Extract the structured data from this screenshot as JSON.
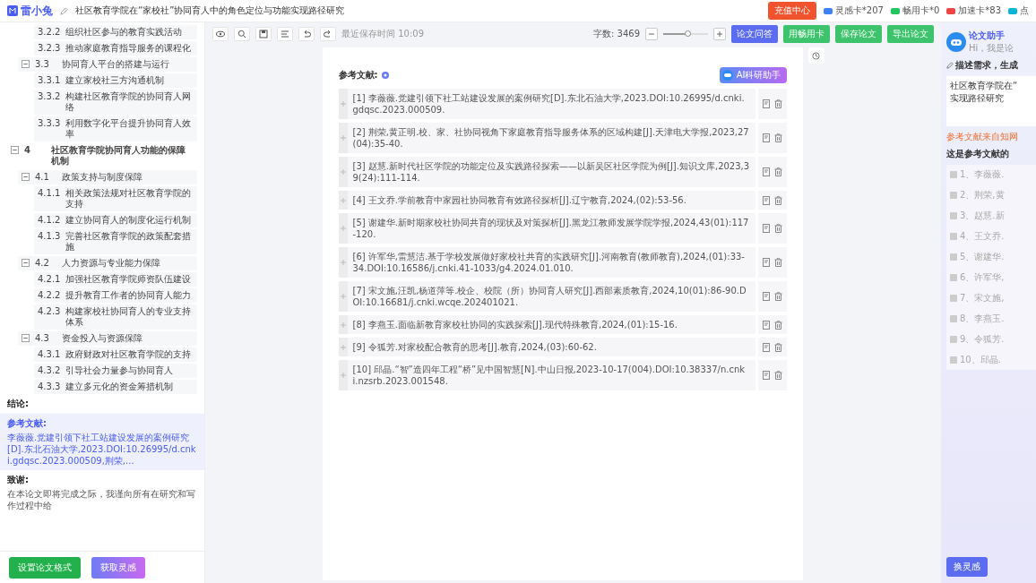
{
  "app": {
    "logo": "雷小兔",
    "title": "社区教育学院在“家校社”协同育人中的角色定位与功能实现路径研究"
  },
  "top_actions": {
    "recharge": "充值中心",
    "cards": [
      {
        "label": "灵感卡*207",
        "color": "#3b82f6"
      },
      {
        "label": "畅用卡*0",
        "color": "#22c55e"
      },
      {
        "label": "加速卡*83",
        "color": "#ef4444"
      },
      {
        "label": "点",
        "color": "#06b6d4"
      }
    ]
  },
  "sidebar": {
    "outline": [
      {
        "children": [
          {
            "children": [
              {
                "number": "3.2.2",
                "title": "组织社区参与的教育实践活动"
              },
              {
                "number": "3.2.3",
                "title": "推动家庭教育指导服务的课程化"
              }
            ]
          },
          {
            "number": "3.3",
            "title": "协同育人平台的搭建与运行",
            "expanded": true,
            "children": [
              {
                "number": "3.3.1",
                "title": "建立家校社三方沟通机制"
              },
              {
                "number": "3.3.2",
                "title": "构建社区教育学院的协同育人网络"
              },
              {
                "number": "3.3.3",
                "title": "利用数字化平台提升协同育人效率"
              }
            ]
          }
        ]
      },
      {
        "number": "4",
        "title": "社区教育学院协同育人功能的保障机制",
        "expanded": true,
        "children": [
          {
            "number": "4.1",
            "title": "政策支持与制度保障",
            "expanded": true,
            "children": [
              {
                "number": "4.1.1",
                "title": "相关政策法规对社区教育学院的支持"
              },
              {
                "number": "4.1.2",
                "title": "建立协同育人的制度化运行机制"
              },
              {
                "number": "4.1.3",
                "title": "完善社区教育学院的政策配套措施"
              }
            ]
          },
          {
            "number": "4.2",
            "title": "人力资源与专业能力保障",
            "expanded": true,
            "children": [
              {
                "number": "4.2.1",
                "title": "加强社区教育学院师资队伍建设"
              },
              {
                "number": "4.2.2",
                "title": "提升教育工作者的协同育人能力"
              },
              {
                "number": "4.2.3",
                "title": "构建家校社协同育人的专业支持体系"
              }
            ]
          },
          {
            "number": "4.3",
            "title": "资金投入与资源保障",
            "expanded": true,
            "children": [
              {
                "number": "4.3.1",
                "title": "政府财政对社区教育学院的支持"
              },
              {
                "number": "4.3.2",
                "title": "引导社会力量参与协同育人"
              },
              {
                "number": "4.3.3",
                "title": "建立多元化的资金筹措机制"
              }
            ]
          }
        ]
      }
    ],
    "sections": [
      {
        "heading": "结论:",
        "selected": false
      },
      {
        "heading": "参考文献:",
        "text": "李薇薇.党建引领下社工站建设发展的案例研究[D].东北石油大学,2023.DOI:10.26995/d.cnki.gdqsc.2023.000509,荆荣,...",
        "selected": true
      },
      {
        "heading": "致谢:",
        "text": "在本论文即将完成之际，我谨向所有在研究和写作过程中给",
        "selected": false
      }
    ],
    "buttons": [
      {
        "label": "设置论文格式",
        "kind": "format"
      },
      {
        "label": "获取灵感",
        "kind": "inspire"
      }
    ]
  },
  "toolbar": {
    "save_time": "最近保存时间 10:09",
    "word_count": "字数: 3469",
    "zoom": {
      "level": 0.55
    },
    "buttons": [
      {
        "label": "论文问答",
        "kind": "primary"
      },
      {
        "label": "用畅用卡",
        "kind": "success"
      },
      {
        "label": "保存论文",
        "kind": "success"
      },
      {
        "label": "导出论文",
        "kind": "success"
      }
    ]
  },
  "document": {
    "heading": "参考文献:",
    "ai_button": "AI科研助手",
    "references": [
      "[1] 李薇薇.党建引领下社工站建设发展的案例研究[D].东北石油大学,2023.DOI:10.26995/d.cnki.gdqsc.2023.000509.",
      "[2] 荆荣,黄正明.校、家、社协同视角下家庭教育指导服务体系的区域构建[J].天津电大学报,2023,27(04):35-40.",
      "[3] 赵慧.新时代社区学院的功能定位及实践路径探索——以新吴区社区学院为例[J].知识文库,2023,39(24):111-114.",
      "[4] 王文乔.学前教育中家园社协同教育有效路径探析[J].辽宁教育,2024,(02):53-56.",
      "[5] 谢建华.新时期家校社协同共育的现状及对策探析[J].黑龙江教师发展学院学报,2024,43(01):117-120.",
      "[6] 许军华,雷慧洁.基于学校发展做好家校社共育的实践研究[J].河南教育(教师教育),2024,(01):33-34.DOI:10.16586/j.cnki.41-1033/g4.2024.01.010.",
      "[7] 宋文施,汪凯,杨道萍等.校企、校院（所）协同育人研究[J].西部素质教育,2024,10(01):86-90.DOI:10.16681/j.cnki.wcqe.202401021.",
      "[8] 李燕玉.面临新教育家校社协同的实践探索[J].现代特殊教育,2024,(01):15-16.",
      "[9] 令狐芳.对家校配合教育的思考[J].教育,2024,(03):60-62.",
      "[10] 邱晶.“智”造四年工程“桥”见中国智慧[N].中山日报,2023-10-17(004).DOI:10.38337/n.cnki.nzsrb.2023.001548."
    ]
  },
  "assistant": {
    "title": "论文助手",
    "greeting": "Hi，我是论",
    "prompt_label": "描述需求，生成",
    "prompt_lines": [
      "社区教育学院在“",
      "实现路径研究"
    ],
    "note": "参考文献来自知网",
    "list_title": "这是参考文献的",
    "items": [
      {
        "text": "1、李薇薇.",
        "checked": false
      },
      {
        "text": "2、荆荣,黄",
        "checked": false
      },
      {
        "text": "3、赵慧.新",
        "checked": false
      },
      {
        "text": "4、王文乔.",
        "checked": false
      },
      {
        "text": "5、谢建华.",
        "checked": false
      },
      {
        "text": "6、许军华,",
        "checked": false
      },
      {
        "text": "7、宋文施,",
        "checked": false
      },
      {
        "text": "8、李燕玉.",
        "checked": false
      },
      {
        "text": "9、令狐芳.",
        "checked": false
      },
      {
        "text": "10、邱晶.",
        "checked": false
      }
    ],
    "button": "换灵感"
  }
}
